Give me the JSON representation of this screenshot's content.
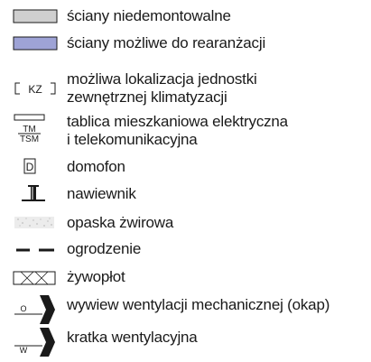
{
  "legend": {
    "items": [
      {
        "key": "sciany-niedemontowalne",
        "symbol": "grey-wall-rect",
        "lines": [
          "ściany niedemontowalne"
        ]
      },
      {
        "key": "sciany-do-rearanzacji",
        "symbol": "blue-wall-rect",
        "lines": [
          "ściany możliwe do rearanżacji"
        ]
      },
      {
        "key": "jednostka-klimatyzacji",
        "symbol": "kz-bracket-box",
        "symbol_text": "KZ",
        "lines": [
          "możliwa lokalizacja jednostki",
          "zewnętrznej klimatyzacji"
        ]
      },
      {
        "key": "tablica-tm-tsm",
        "symbol": "tm-tsm-panel",
        "symbol_text_top": "TM",
        "symbol_text_bottom": "TSM",
        "lines": [
          "tablica mieszkaniowa elektryczna",
          "i telekomunikacyjna"
        ]
      },
      {
        "key": "domofon",
        "symbol": "intercom-box",
        "symbol_text": "D",
        "lines": [
          "domofon"
        ]
      },
      {
        "key": "nawiewnik",
        "symbol": "air-inlet-symbol",
        "lines": [
          "nawiewnik"
        ]
      },
      {
        "key": "opaska-zwirowa",
        "symbol": "gravel-strip",
        "lines": [
          "opaska żwirowa"
        ]
      },
      {
        "key": "ogrodzenie",
        "symbol": "dashed-fence-line",
        "lines": [
          "ogrodzenie"
        ]
      },
      {
        "key": "zywoplot",
        "symbol": "hedge-crossed-rect",
        "lines": [
          "żywopłot"
        ]
      },
      {
        "key": "wywiew-okap",
        "symbol": "exhaust-arrow",
        "symbol_text": "O",
        "lines": [
          "wywiew wentylacji mechanicznej (okap)"
        ]
      },
      {
        "key": "kratka-wentylacyjna",
        "symbol": "vent-arrow",
        "symbol_text": "W",
        "lines": [
          "kratka wentylacyjna"
        ]
      }
    ],
    "colors": {
      "grey_wall": "#cfcfcf",
      "blue_wall": "#9ea3d6",
      "stroke": "#1a1a1a",
      "gravel": "#e8e8e8"
    }
  }
}
